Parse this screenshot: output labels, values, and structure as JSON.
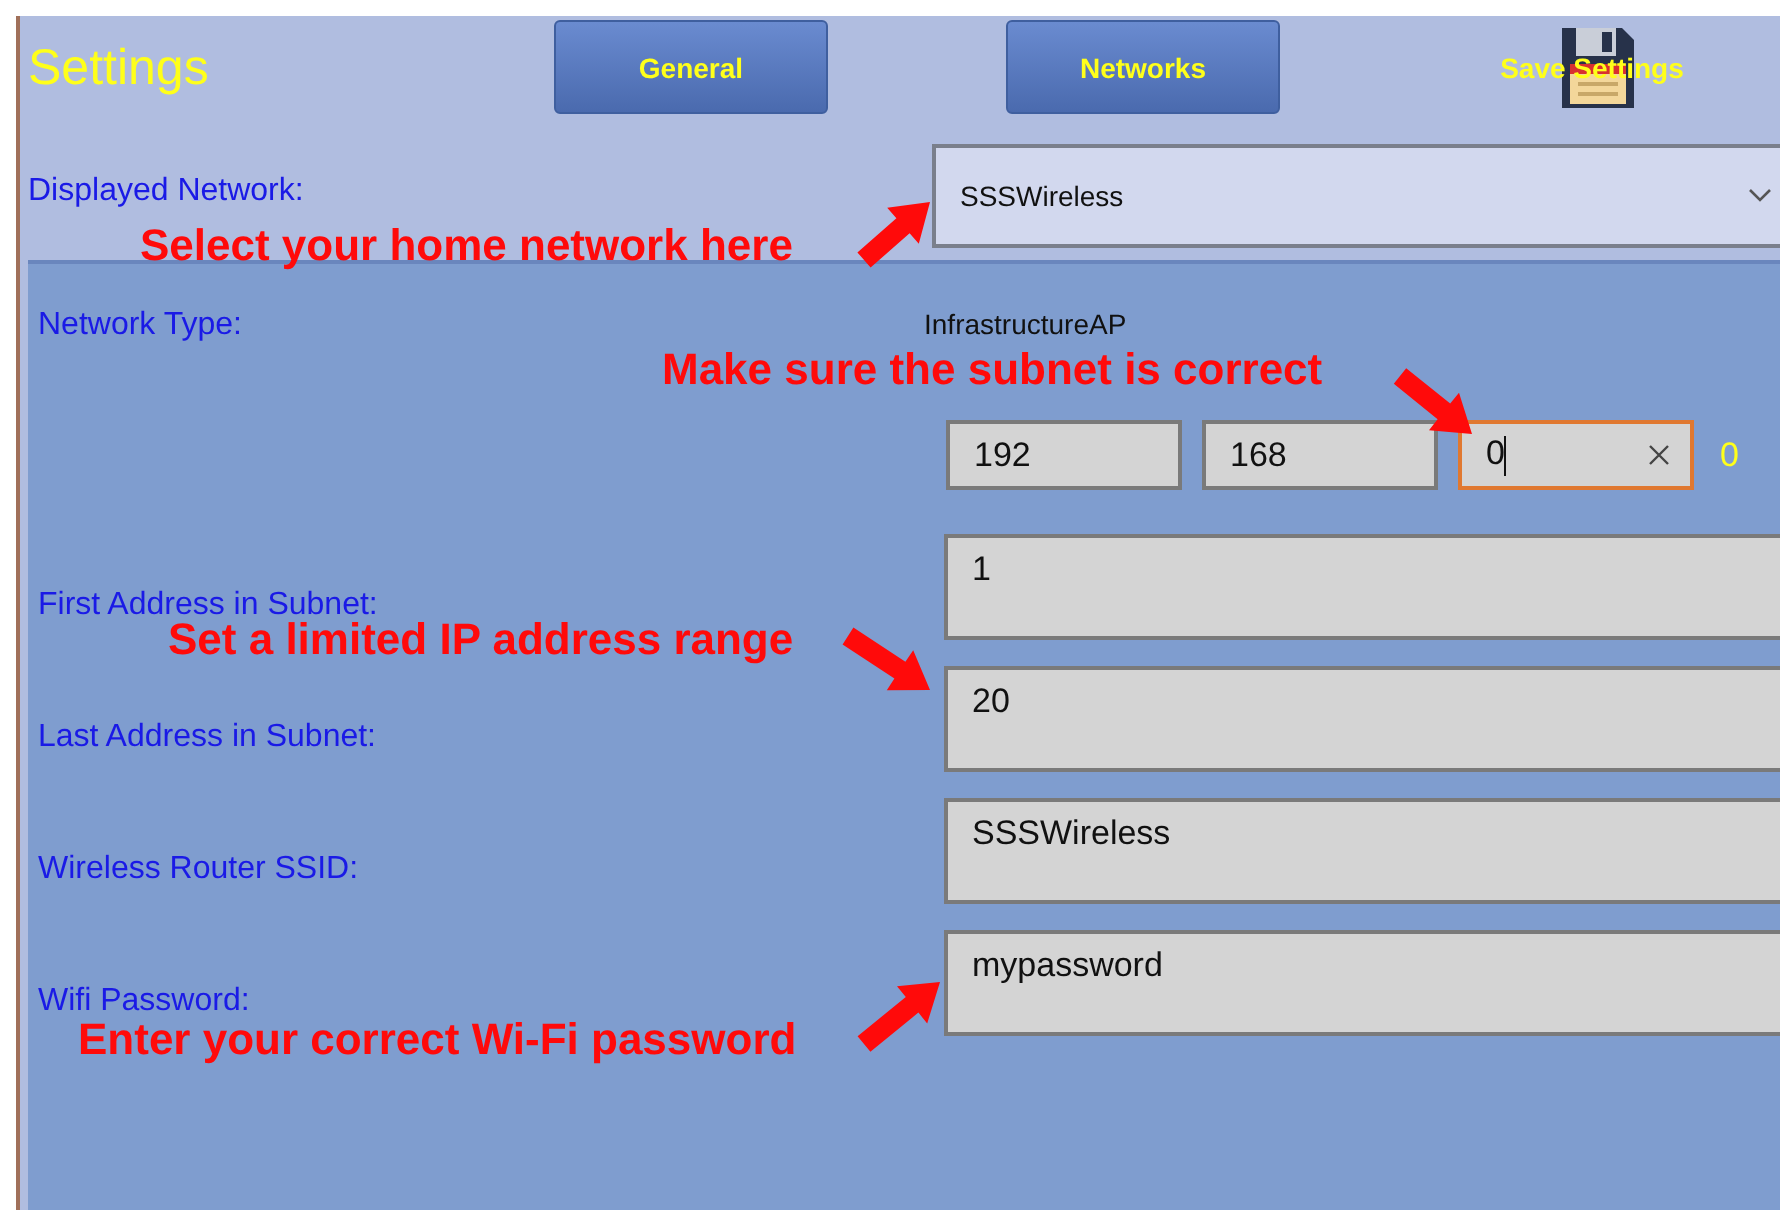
{
  "title": "Settings",
  "buttons": [
    {
      "kind": "tab",
      "label": "General"
    },
    {
      "kind": "tab",
      "label": "Networks"
    },
    {
      "kind": "save",
      "label": "Save Settings"
    }
  ],
  "displayed_network": {
    "label": "Displayed Network:",
    "value": "SSSWireless"
  },
  "network_type": {
    "label": "Network Type:",
    "value": "InfrastructureAP"
  },
  "subnet": {
    "octets": [
      {
        "value": "192",
        "focused": false
      },
      {
        "value": "168",
        "focused": false
      },
      {
        "value": "0",
        "focused": true
      }
    ],
    "reading": "0"
  },
  "fields": [
    {
      "label": "First Address in Subnet:",
      "value": "1"
    },
    {
      "label": "Last Address in Subnet:",
      "value": "20"
    },
    {
      "label": "Wireless Router SSID:",
      "value": "SSSWireless"
    },
    {
      "label": "Wifi Password:",
      "value": "mypassword"
    }
  ],
  "annotations": [
    "Select your home network here",
    "Make sure the subnet is correct",
    "Set a limited IP address range",
    "Enter your correct Wi-Fi password"
  ]
}
